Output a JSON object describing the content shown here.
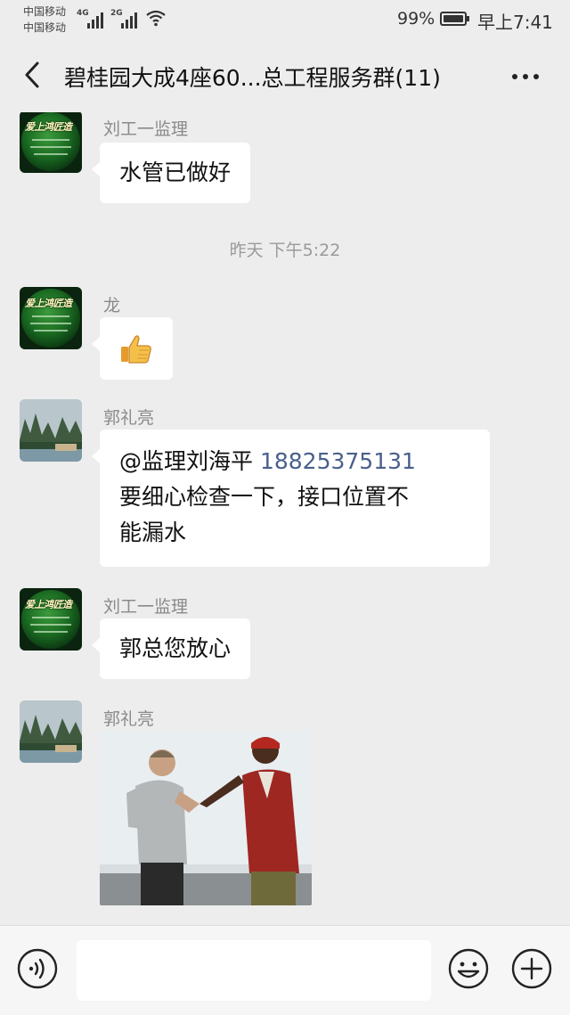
{
  "status_bar": {
    "carrier1": "中国移动",
    "carrier2": "中国移动",
    "net1": "4G",
    "net2": "2G",
    "battery_percent": "99%",
    "battery_level": 0.99,
    "time": "早上7:41"
  },
  "header": {
    "title": "碧桂园大成4座60...总工程服务群(11)",
    "back_icon": "chevron-left-icon",
    "more_icon": "more-dots-icon"
  },
  "messages": [
    {
      "sender": "刘工一监理",
      "text": "水管已做好"
    },
    {
      "timestamp": "昨天 下午5:22"
    },
    {
      "sender": "龙",
      "content": "thumbs-up-emoji"
    },
    {
      "sender": "郭礼亮",
      "mention": "@监理刘海平",
      "phone": "18825375131",
      "line2": "要细心检查一下，接口位置不",
      "line3": "能漏水"
    },
    {
      "sender": "刘工一监理",
      "text": "郭总您放心"
    },
    {
      "sender": "郭礼亮",
      "content": "photo"
    }
  ],
  "input_bar": {
    "voice_icon": "voice-icon",
    "emoji_icon": "emoji-icon",
    "plus_icon": "plus-icon"
  },
  "colors": {
    "background": "#ededed",
    "bubble": "#ffffff",
    "link": "#4a5f8c"
  }
}
